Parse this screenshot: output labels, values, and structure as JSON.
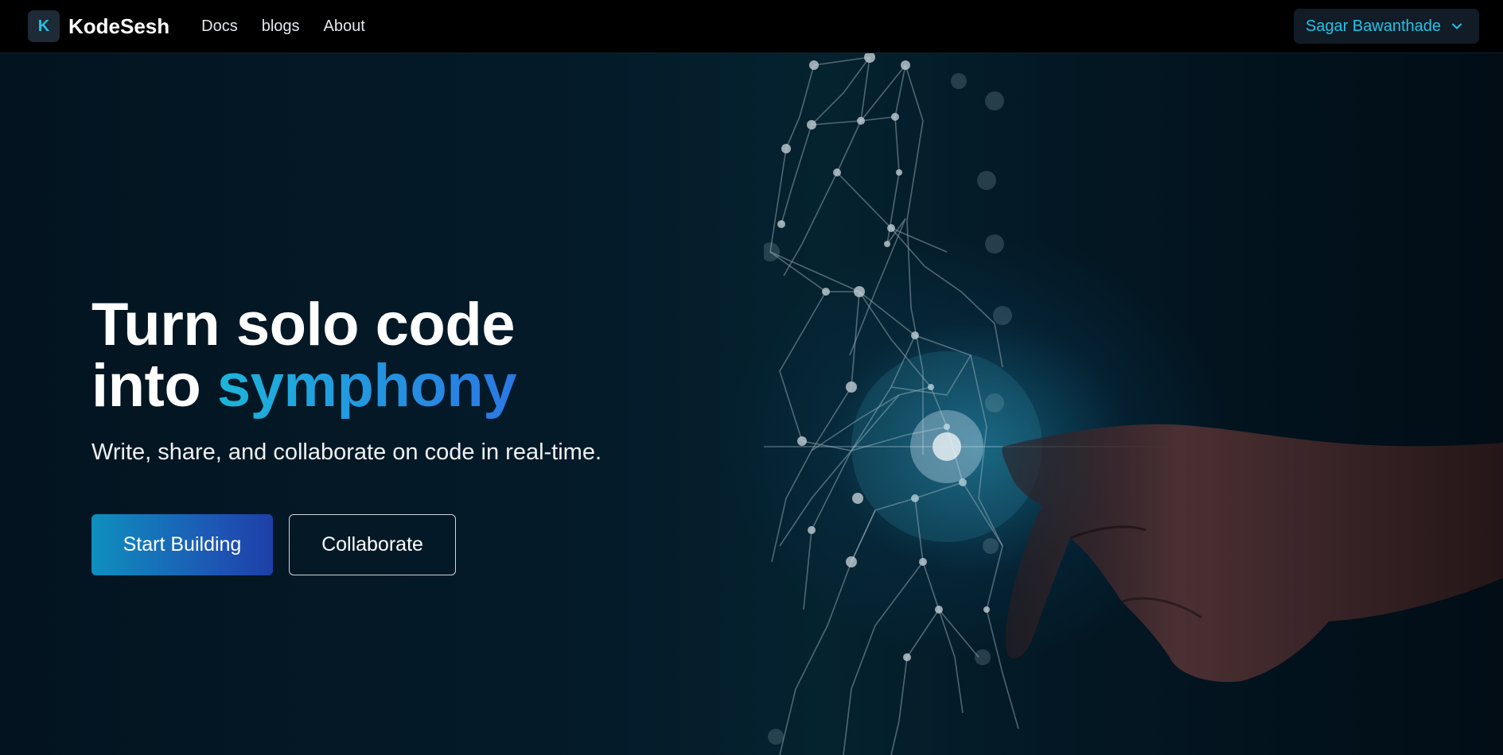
{
  "navbar": {
    "logo_letter": "K",
    "brand": "KodeSesh",
    "links": [
      "Docs",
      "blogs",
      "About"
    ],
    "user_name": "Sagar Bawanthade"
  },
  "hero": {
    "title_line1": "Turn solo code",
    "title_line2_prefix": "into ",
    "title_line2_accent": "symphony",
    "subtitle": "Write, share, and collaborate on code in real-time.",
    "primary_button": "Start Building",
    "secondary_button": "Collaborate"
  },
  "colors": {
    "accent_cyan": "#22c3e6",
    "accent_gradient_start": "#1cb5da",
    "accent_gradient_end": "#2b78e4",
    "background": "#020a12"
  },
  "icons": {
    "user_menu": "chevron-down-icon",
    "hero_art": "network-mesh-illustration"
  }
}
